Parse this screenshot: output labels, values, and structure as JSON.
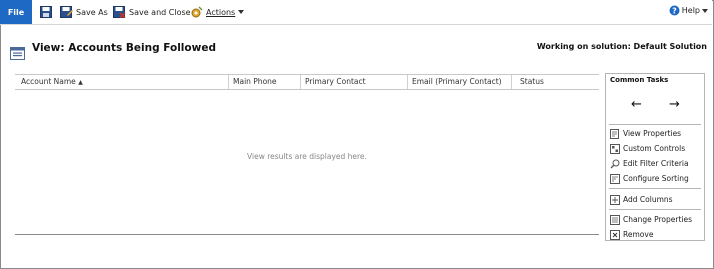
{
  "toolbar": {
    "file_label": "File",
    "save_as_label": "Save As",
    "save_close_label": "Save and Close",
    "actions_label": "Actions",
    "help_label": "Help"
  },
  "header": {
    "title": "View: Accounts Being Followed",
    "solution": "Working on solution: Default Solution"
  },
  "grid": {
    "columns": [
      "Account Name",
      "Main Phone",
      "Primary Contact",
      "Email (Primary Contact)",
      "Status"
    ],
    "sorted_indicator": "▲",
    "empty_message": "View results are displayed here."
  },
  "tasks": {
    "title": "Common Tasks",
    "left_arrow": "←",
    "right_arrow": "→",
    "items": [
      "View Properties",
      "Custom Controls",
      "Edit Filter Criteria",
      "Configure Sorting",
      "Add Columns",
      "Change Properties",
      "Remove"
    ]
  }
}
